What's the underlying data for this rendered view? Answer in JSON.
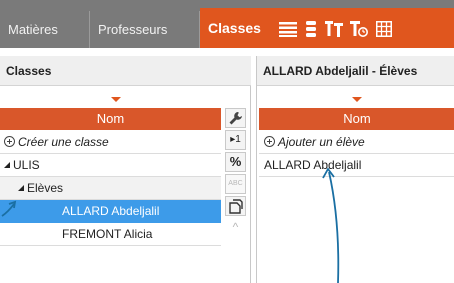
{
  "tabs": [
    {
      "label": "Matières"
    },
    {
      "label": "Professeurs"
    }
  ],
  "active_tab": {
    "label": "Classes"
  },
  "tab_icons": [
    "list-icon",
    "vertical-list-icon",
    "teachers-icon",
    "teacher-clock-icon",
    "grid-icon"
  ],
  "left_panel": {
    "title": "Classes",
    "column_header": "Nom",
    "create_label": "Créer une classe",
    "group_label": "ULIS",
    "subgroup_label": "Elèves",
    "students": [
      "ALLARD Abdeljalil",
      "FREMONT Alicia"
    ]
  },
  "tools": {
    "wrench": "wrench-icon",
    "step": "▸1",
    "percent": "%",
    "abc": "ABC",
    "doc": "document-icon",
    "up": "^"
  },
  "right_panel": {
    "title": "ALLARD Abdeljalil - Élèves",
    "column_header": "Nom",
    "add_label": "Ajouter un élève",
    "student": "ALLARD Abdeljalil"
  },
  "colors": {
    "accent": "#e0561e",
    "tab_bar": "#7a7a7a",
    "selection": "#3d9be9",
    "annotation_arrow": "#1a6fa3"
  }
}
